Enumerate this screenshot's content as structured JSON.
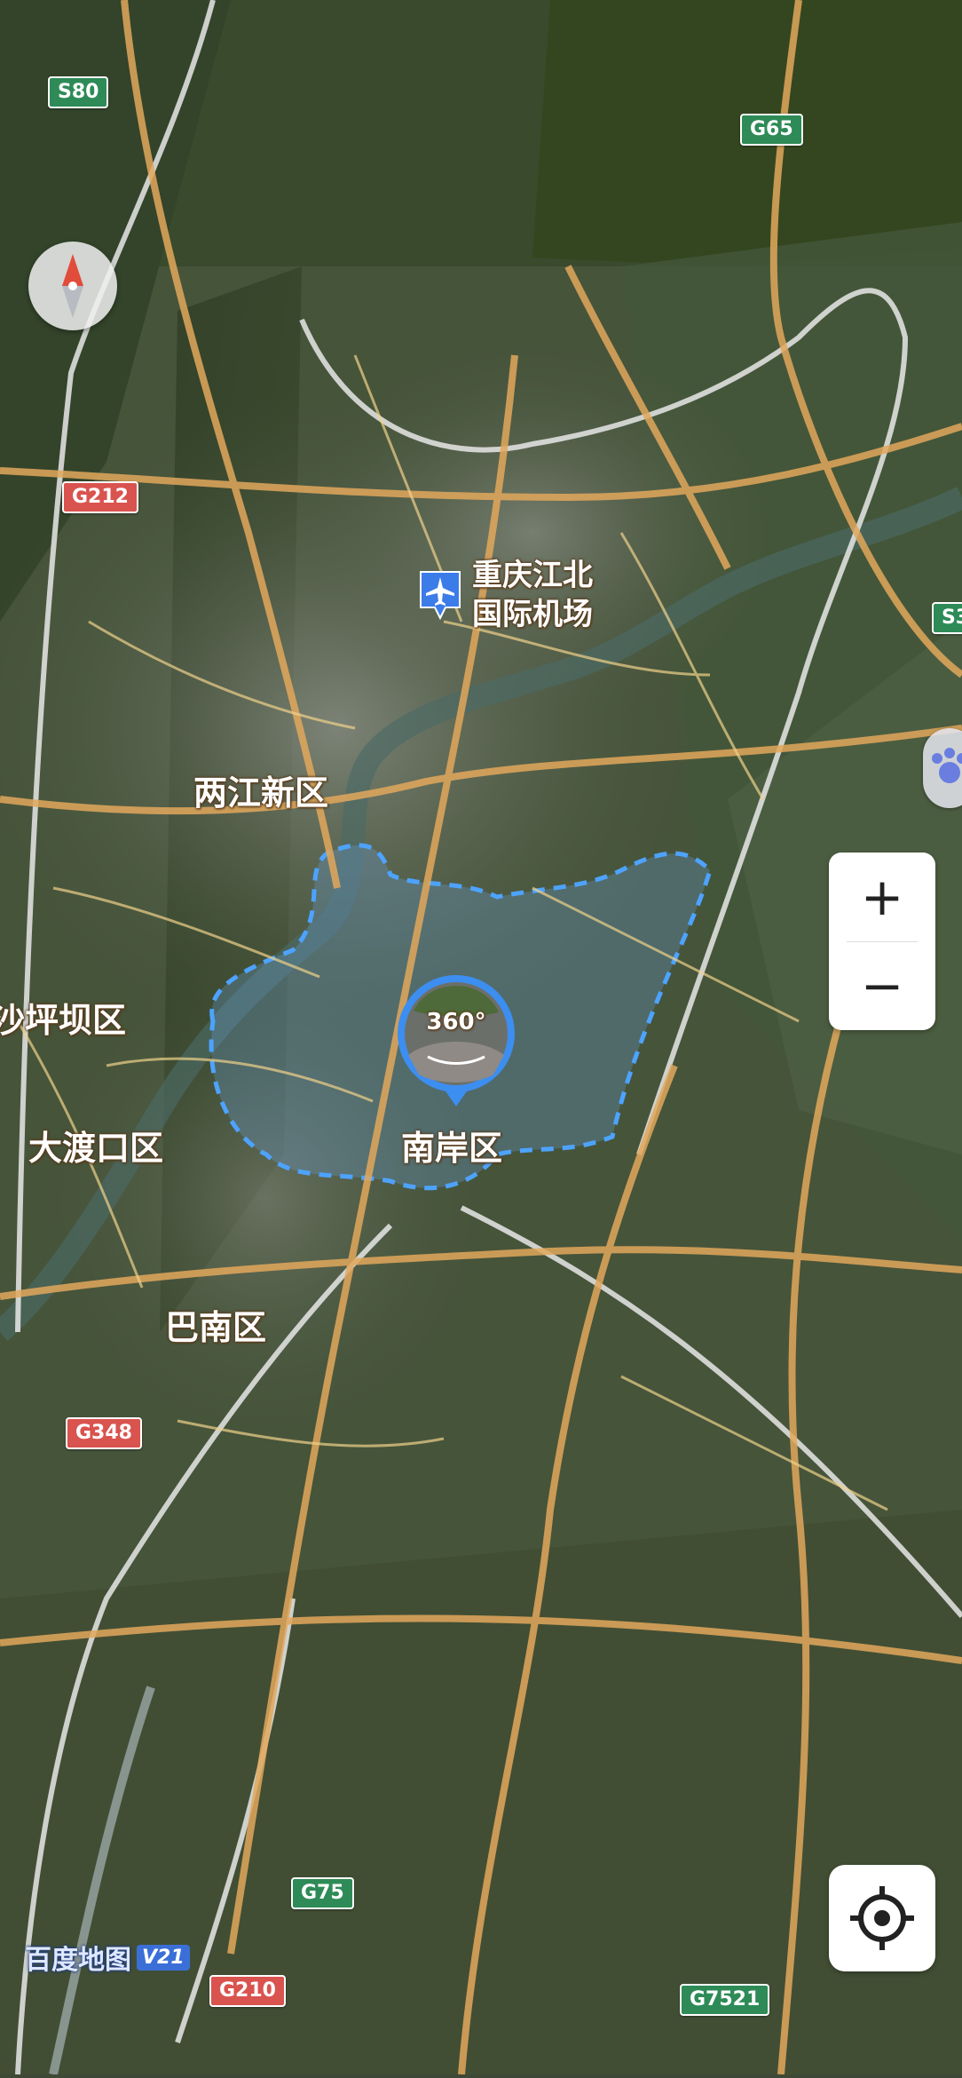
{
  "map": {
    "districts": [
      {
        "name": "两江新区"
      },
      {
        "name": "沙坪坝区"
      },
      {
        "name": "大渡口区"
      },
      {
        "name": "南岸区"
      },
      {
        "name": "巴南区"
      }
    ],
    "airport": {
      "line1": "重庆江北",
      "line2": "国际机场",
      "icon": "airplane-icon"
    },
    "panorama": {
      "label": "360°",
      "icon": "panorama-360-icon"
    },
    "highway_shields": [
      {
        "code": "S80",
        "color": "#2e8b57"
      },
      {
        "code": "G65",
        "color": "#2e8b57"
      },
      {
        "code": "G212",
        "color": "#d9534f"
      },
      {
        "code": "S3",
        "color": "#2e8b57"
      },
      {
        "code": "G348",
        "color": "#d9534f"
      },
      {
        "code": "G75",
        "color": "#2e8b57"
      },
      {
        "code": "G210",
        "color": "#d9534f"
      },
      {
        "code": "G7521",
        "color": "#2e8b57"
      }
    ],
    "attribution": {
      "brand": "百度地图",
      "version": "V21"
    }
  },
  "controls": {
    "zoom_in": "+",
    "zoom_out": "−",
    "compass_icon": "compass-icon",
    "locate_icon": "locate-icon"
  },
  "colors": {
    "road_major": "#e2a85c",
    "road_minor": "#f0d28a",
    "expressway": "#e8e8e8",
    "district_boundary": "#4da3ff"
  }
}
